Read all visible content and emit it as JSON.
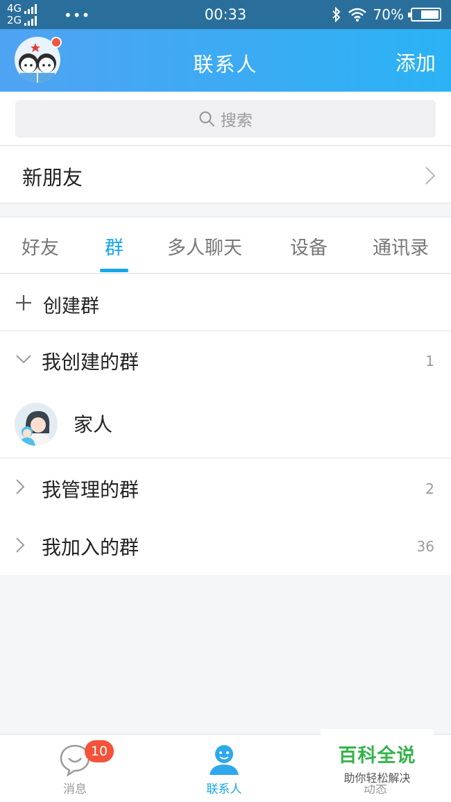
{
  "status_bar": {
    "net_top": "4G",
    "net_bottom": "2G",
    "dots": "•••",
    "time": "00:33",
    "battery": "70%",
    "battery_level": 0.7
  },
  "header": {
    "title": "联系人",
    "add_label": "添加"
  },
  "search": {
    "placeholder": "搜索"
  },
  "new_friends": {
    "label": "新朋友"
  },
  "tabs": [
    {
      "label": "好友",
      "active": false
    },
    {
      "label": "群",
      "active": true
    },
    {
      "label": "多人聊天",
      "active": false
    },
    {
      "label": "设备",
      "active": false
    },
    {
      "label": "通讯录",
      "active": false
    }
  ],
  "create_group": {
    "label": "创建群"
  },
  "groups": [
    {
      "label": "我创建的群",
      "count": "1",
      "expanded": true
    },
    {
      "label": "我管理的群",
      "count": "2",
      "expanded": false
    },
    {
      "label": "我加入的群",
      "count": "36",
      "expanded": false
    }
  ],
  "created_groups": [
    {
      "name": "家人"
    }
  ],
  "bottom_nav": [
    {
      "label": "消息",
      "badge": "10",
      "icon": "chat-bubble-icon"
    },
    {
      "label": "联系人",
      "icon": "contacts-person-icon",
      "active": true
    },
    {
      "label": "动态",
      "icon": "star-icon"
    }
  ],
  "watermark": {
    "title": "百科全说",
    "subtitle": "助你轻松解决"
  },
  "colors": {
    "accent": "#16a6ea",
    "header_start": "#4fa3f3",
    "header_end": "#2bb2f5",
    "badge": "#f4523a",
    "watermark": "#35b34a"
  }
}
